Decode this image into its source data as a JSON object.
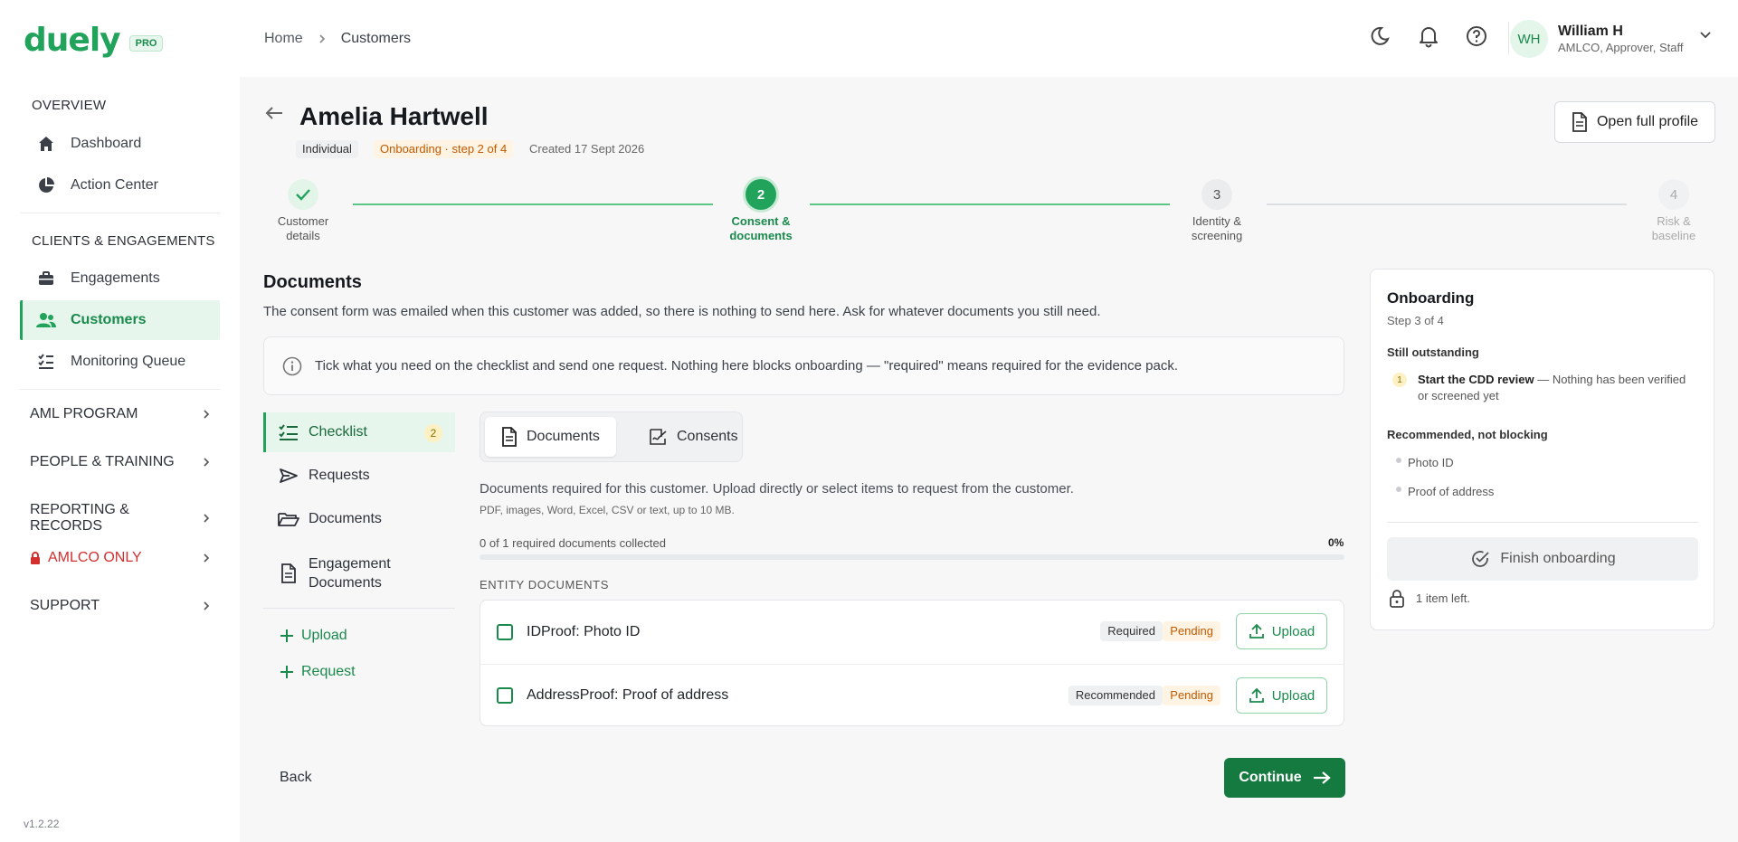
{
  "brand": {
    "name": "duely",
    "badge": "PRO",
    "color": "#21a35b"
  },
  "sidebar": {
    "sections": [
      {
        "title": "OVERVIEW",
        "items": [
          {
            "label": "Dashboard",
            "icon": "home-icon"
          },
          {
            "label": "Action Center",
            "icon": "pie-chart-icon"
          }
        ]
      },
      {
        "title": "CLIENTS & ENGAGEMENTS",
        "items": [
          {
            "label": "Engagements",
            "icon": "briefcase-icon"
          },
          {
            "label": "Customers",
            "icon": "users-icon",
            "active": true
          },
          {
            "label": "Monitoring Queue",
            "icon": "list-check-icon"
          }
        ]
      }
    ],
    "groups": [
      "AML PROGRAM",
      "PEOPLE & TRAINING",
      "REPORTING & RECORDS",
      "AMLCO ONLY",
      "SUPPORT"
    ],
    "version": "v1.2.22"
  },
  "breadcrumb": {
    "home": "Home",
    "current": "Customers"
  },
  "user": {
    "initials": "WH",
    "name": "William H",
    "roles": "AMLCO, Approver, Staff"
  },
  "customer": {
    "name": "Amelia Hartwell",
    "type_tag": "Individual",
    "status_tag": "Onboarding · step 2 of 4",
    "created": "Created 17 Sept 2026",
    "open_profile_label": "Open full profile"
  },
  "stepper": [
    {
      "number": "1",
      "line1": "Customer",
      "line2": "details",
      "state": "done"
    },
    {
      "number": "2",
      "line1": "Consent &",
      "line2": "documents",
      "state": "active"
    },
    {
      "number": "3",
      "line1": "Identity &",
      "line2": "screening",
      "state": "next"
    },
    {
      "number": "4",
      "line1": "Risk &",
      "line2": "baseline",
      "state": "future"
    }
  ],
  "documents_section": {
    "title": "Documents",
    "description": "The consent form was emailed when this customer was added, so there is nothing to send here. Ask for whatever documents you still need.",
    "info": "Tick what you need on the checklist and send one request. Nothing here blocks onboarding — \"required\" means required for the evidence pack."
  },
  "subnav": {
    "items": [
      {
        "label": "Checklist",
        "badge": "2",
        "active": true
      },
      {
        "label": "Requests"
      },
      {
        "label": "Documents"
      },
      {
        "label_line1": "Engagement",
        "label_line2": "Documents"
      }
    ],
    "actions": [
      "Upload",
      "Request"
    ]
  },
  "tabs": [
    {
      "label": "Documents",
      "active": true
    },
    {
      "label": "Consents"
    }
  ],
  "checklist": {
    "description": "Documents required for this customer. Upload directly or select items to request from the customer.",
    "formats": "PDF, images, Word, Excel, CSV or text, up to 10 MB.",
    "progress_label": "0 of 1 required documents collected",
    "progress_pct_label": "0%",
    "progress_value": 0,
    "group_label": "ENTITY DOCUMENTS",
    "rows": [
      {
        "name": "IDProof: Photo ID",
        "requirement": "Required",
        "status": "Pending",
        "action": "Upload"
      },
      {
        "name": "AddressProof: Proof of address",
        "requirement": "Recommended",
        "status": "Pending",
        "action": "Upload"
      }
    ]
  },
  "footer": {
    "back": "Back",
    "continue": "Continue"
  },
  "panel": {
    "title": "Onboarding",
    "step": "Step 3 of 4",
    "outstanding_heading": "Still outstanding",
    "outstanding_num": "1",
    "outstanding_title": "Start the CDD review",
    "outstanding_detail": " — Nothing has been verified or screened yet",
    "recommended_heading": "Recommended, not blocking",
    "recommended_items": [
      "Photo ID",
      "Proof of address"
    ],
    "finish_label": "Finish onboarding",
    "items_left": "1 item left."
  }
}
